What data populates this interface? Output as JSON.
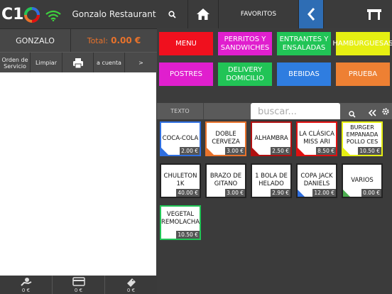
{
  "app": {
    "logo_text": "C1",
    "restaurant": "Gonzalo Restaurant"
  },
  "waiter": {
    "name": "GONZALO"
  },
  "total": {
    "label": "Total:",
    "amount": "0.00 €"
  },
  "actions": [
    {
      "label": "Orden de Servicio"
    },
    {
      "label": "Limpiar"
    },
    {
      "label": "",
      "icon": "printer-icon"
    },
    {
      "label": "a cuenta"
    },
    {
      "label": ">"
    }
  ],
  "bottom": [
    {
      "icon": "cash-hand-icon",
      "value": "0 €"
    },
    {
      "icon": "credit-card-icon",
      "value": "0 €"
    },
    {
      "icon": "ticket-icon",
      "value": "0 €"
    }
  ],
  "topright": {
    "favorites": "FAVORITOS"
  },
  "categories": [
    {
      "label": "MENU",
      "color": "#f0101e"
    },
    {
      "label": "PERRITOS Y SANDWICHES",
      "color": "#e01fce"
    },
    {
      "label": "ENTRANTES Y ENSALADAS",
      "color": "#21c456"
    },
    {
      "label": "HAMBURGUESAS",
      "color": "#e6ef12"
    },
    {
      "label": "POSTRES",
      "color": "#e01fce"
    },
    {
      "label": "DELIVERY DOMICILIO",
      "color": "#21c456"
    },
    {
      "label": "BEBIDAS",
      "color": "#2f7de0"
    },
    {
      "label": "PRUEBA",
      "color": "#ee8033"
    }
  ],
  "search": {
    "tab": "TEXTO",
    "placeholder": "buscar..."
  },
  "products": [
    {
      "name": "COCA-COLA",
      "price": "2.00 €",
      "border": "#2f6fe0"
    },
    {
      "name": "DOBLE CERVEZA",
      "price": "3.00 €",
      "border": "#e8722b"
    },
    {
      "name": "ALHAMBRA",
      "price": "2.50 €",
      "border": "#b01010"
    },
    {
      "name": "LA CLÁSICA MISS ARI",
      "price": "8.50 €",
      "border": "#e01010"
    },
    {
      "name": "BURGER EMPANADA POLLO CES",
      "price": "10.50 €",
      "border": "#e6ef12"
    },
    {
      "name": "CHULETON 1K",
      "price": "40.00 €",
      "border": "#222222"
    },
    {
      "name": "BRAZO DE GITANO",
      "price": "3.00 €",
      "border": "#222222"
    },
    {
      "name": "1 BOLA DE HELADO",
      "price": "2.90 €",
      "border": "#222222"
    },
    {
      "name": "COPA JACK DANIELS",
      "price": "12.00 €",
      "border": "#222222"
    },
    {
      "name": "VARIOS",
      "price": "0.00 €",
      "border": "#222222"
    },
    {
      "name": "VEGETAL REMOLACHA",
      "price": "10.50 €",
      "border": "#21c456"
    }
  ],
  "product_triangle_colors": [
    "#2f6fe0",
    "#e8722b",
    "#b01010",
    "#e01010",
    "#e6ef12",
    "",
    "",
    "",
    "#2f6fe0",
    "#4caf50",
    "#21c456"
  ]
}
